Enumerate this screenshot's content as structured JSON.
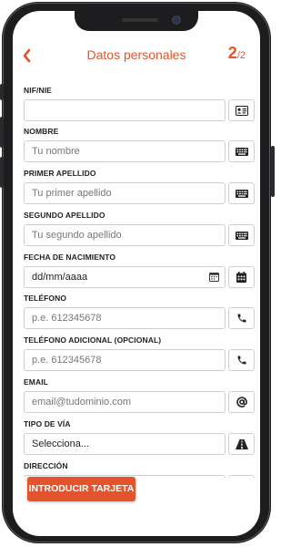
{
  "header": {
    "title": "Datos personales",
    "step_current": "2",
    "step_total": "/2"
  },
  "fields": [
    {
      "label": "NIF/NIE",
      "value": "",
      "placeholder": "",
      "icon": "id-card-icon"
    },
    {
      "label": "NOMBRE",
      "placeholder": "Tu nombre",
      "icon": "keyboard-icon"
    },
    {
      "label": "PRIMER APELLIDO",
      "placeholder": "Tu primer apellido",
      "icon": "keyboard-icon"
    },
    {
      "label": "SEGUNDO APELLIDO",
      "placeholder": "Tu segundo apellido",
      "icon": "keyboard-icon"
    },
    {
      "label": "FECHA DE NACIMIENTO",
      "value": "dd/mm/aaaa",
      "icon": "calendar-icon"
    },
    {
      "label": "TELÉFONO",
      "placeholder": "p.e. 612345678",
      "icon": "phone-icon"
    },
    {
      "label": "TELÉFONO ADICIONAL (OPCIONAL)",
      "placeholder": "p.e. 612345678",
      "icon": "phone-icon"
    },
    {
      "label": "EMAIL",
      "placeholder": "email@tudominio.com",
      "icon": "at-icon"
    },
    {
      "label": "TIPO DE VÍA",
      "value": "Selecciona...",
      "icon": "road-icon"
    },
    {
      "label": "DIRECCIÓN",
      "placeholder": "",
      "icon": "map-pin-icon"
    }
  ],
  "cta": {
    "label": "INTRODUCIR TARJETA"
  },
  "colors": {
    "accent": "#e5532c",
    "border": "#cfcfcf",
    "frame": "#1d1d1f"
  }
}
